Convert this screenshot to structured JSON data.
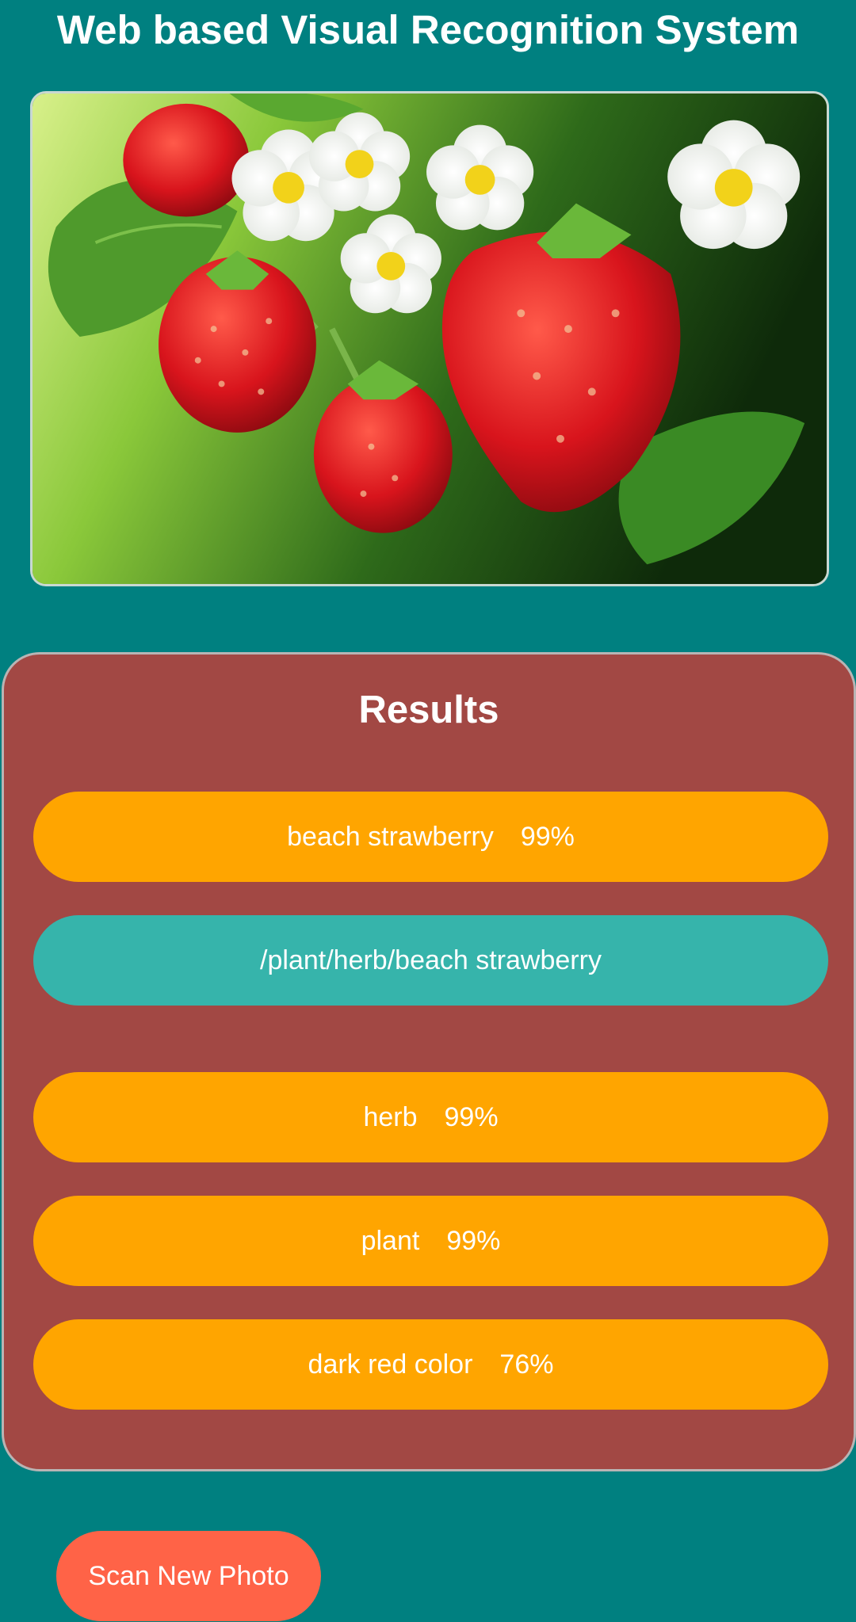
{
  "header": {
    "title": "Web based Visual Recognition System"
  },
  "photo": {
    "subject": "strawberries with white blossoms",
    "icon": "photo-image"
  },
  "results": {
    "title": "Results",
    "top_class": {
      "label": "beach strawberry",
      "score": "99%"
    },
    "hierarchy": "/plant/herb/beach strawberry",
    "classes": [
      {
        "label": "herb",
        "score": "99%"
      },
      {
        "label": "plant",
        "score": "99%"
      },
      {
        "label": "dark red color",
        "score": "76%"
      }
    ]
  },
  "actions": {
    "scan_label": "Scan New Photo"
  },
  "colors": {
    "background": "#008080",
    "card": "#a24844",
    "pill_orange": "#ffa500",
    "pill_teal": "#36b4ab",
    "button": "#ff6347"
  }
}
